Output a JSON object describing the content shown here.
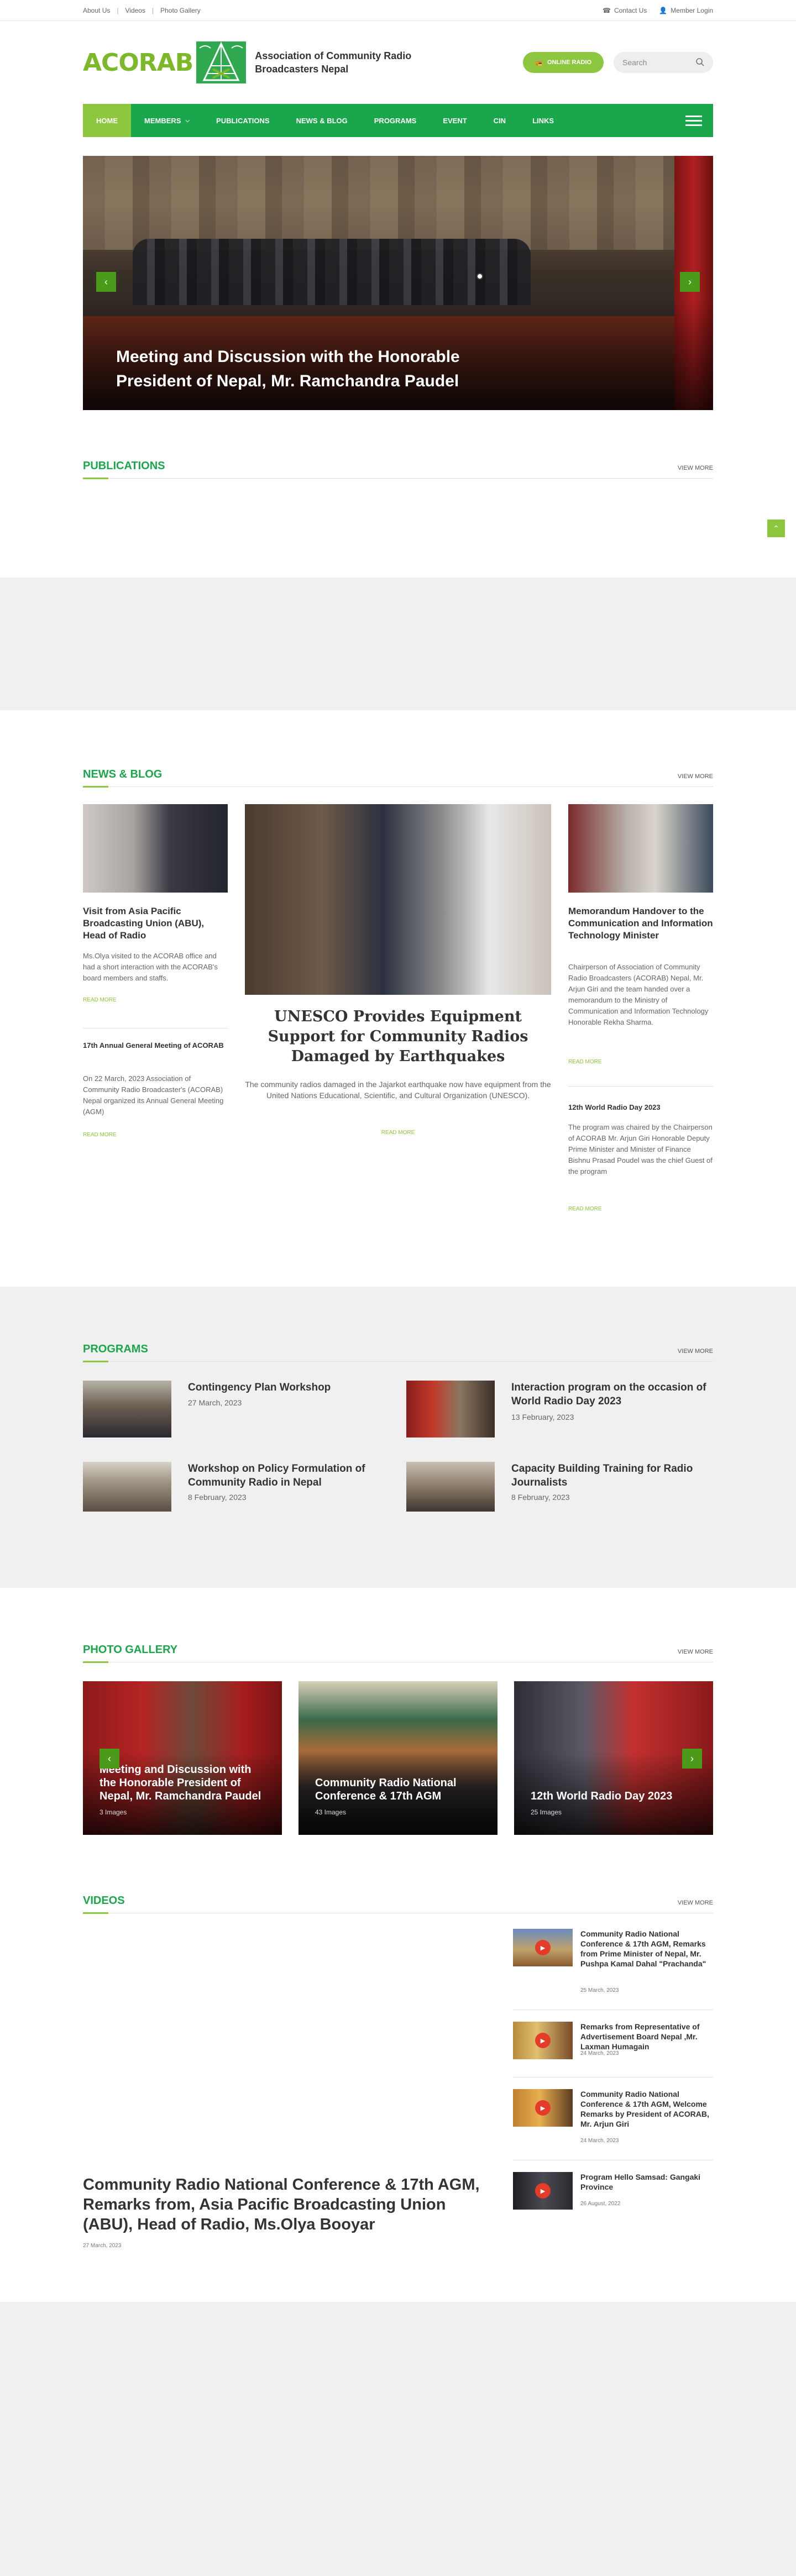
{
  "topbar": {
    "links": [
      "About Us",
      "Videos",
      "Photo Gallery"
    ],
    "contact": "Contact Us",
    "login": "Member Login"
  },
  "header": {
    "logo_text": "ACORAB",
    "org_name_line1": "Association of Community Radio",
    "org_name_line2": "Broadcasters Nepal",
    "online_radio": "ONLINE RADIO",
    "search_placeholder": "Search"
  },
  "nav": {
    "items": [
      "HOME",
      "MEMBERS",
      "PUBLICATIONS",
      "NEWS & BLOG",
      "PROGRAMS",
      "EVENT",
      "CIN",
      "LINKS"
    ]
  },
  "hero": {
    "title": "Meeting and Discussion with the Honorable President of Nepal, Mr. Ramchandra Paudel"
  },
  "publications": {
    "title": "PUBLICATIONS",
    "more": "VIEW MORE"
  },
  "news": {
    "title": "NEWS & BLOG",
    "more": "VIEW MORE",
    "left": [
      {
        "title": "Visit from Asia Pacific Broadcasting Union (ABU), Head of Radio",
        "body": "Ms.Olya visited to the ACORAB office and had a short interaction with the ACORAB's board members and staffs.",
        "read": "READ MORE"
      },
      {
        "title": "17th Annual General Meeting of ACORAB",
        "body": "On 22 March, 2023 Association of Community Radio Broadcaster's (ACORAB) Nepal organized its Annual General Meeting (AGM)",
        "read": "READ MORE"
      }
    ],
    "center": {
      "title": "UNESCO Provides Equipment Support for Community Radios Damaged by Earthquakes",
      "body": "The community radios damaged in the Jajarkot earthquake now have equipment from the United Nations Educational, Scientific, and Cultural Organization (UNESCO).",
      "read": "READ MORE"
    },
    "right": [
      {
        "title": "Memorandum Handover to the Communication and Information Technology Minister",
        "body": "Chairperson of Association of Community Radio Broadcasters (ACORAB) Nepal, Mr. Arjun Giri and the team handed over a memorandum to the Ministry of Communication and Information Technology Honorable Rekha Sharma.",
        "read": "READ MORE"
      },
      {
        "title": "12th World Radio Day 2023",
        "body": "The program was chaired by the Chairperson of ACORAB Mr. Arjun Giri Honorable Deputy Prime Minister and Minister of Finance Bishnu Prasad Poudel was the chief Guest of the program",
        "read": "READ MORE"
      }
    ]
  },
  "programs": {
    "title": "PROGRAMS",
    "more": "VIEW MORE",
    "items": [
      {
        "title": "Contingency Plan Workshop",
        "date": "27 March, 2023"
      },
      {
        "title": "Interaction program on the occasion of World Radio Day 2023",
        "date": "13 February, 2023"
      },
      {
        "title": "Workshop on Policy Formulation of Community Radio in Nepal",
        "date": "8 February, 2023"
      },
      {
        "title": "Capacity Building Training for Radio Journalists",
        "date": "8 February, 2023"
      }
    ]
  },
  "gallery": {
    "title": "PHOTO GALLERY",
    "more": "VIEW MORE",
    "items": [
      {
        "title": "Meeting and Discussion with the Honorable President of Nepal, Mr. Ramchandra Paudel",
        "count": "3 Images"
      },
      {
        "title": "Community Radio National Conference & 17th AGM",
        "count": "43 Images"
      },
      {
        "title": "12th World Radio Day 2023",
        "count": "25 Images"
      }
    ]
  },
  "videos": {
    "title": "VIDEOS",
    "more": "VIEW MORE",
    "main": {
      "title": "Community Radio National Conference & 17th AGM, Remarks from, Asia Pacific Broadcasting Union (ABU), Head of Radio, Ms.Olya Booyar",
      "date": "27 March, 2023"
    },
    "items": [
      {
        "title": "Community Radio National Conference & 17th AGM, Remarks from Prime Minister of Nepal, Mr. Pushpa Kamal Dahal \"Prachanda\"",
        "date": "25 March, 2023"
      },
      {
        "title": "Remarks from Representative of Advertisement Board Nepal ,Mr. Laxman Humagain",
        "date": "24 March, 2023"
      },
      {
        "title": "Community Radio National Conference & 17th AGM, Welcome Remarks by President of ACORAB, Mr. Arjun Giri",
        "date": "24 March, 2023"
      },
      {
        "title": "Program Hello Samsad: Gangaki Province",
        "date": "26 August, 2022"
      }
    ]
  },
  "colors": {
    "green": "#1aa64a",
    "lime": "#8dc63f",
    "grey_band": "#f0f0f0",
    "play_red": "#e53c2a"
  }
}
